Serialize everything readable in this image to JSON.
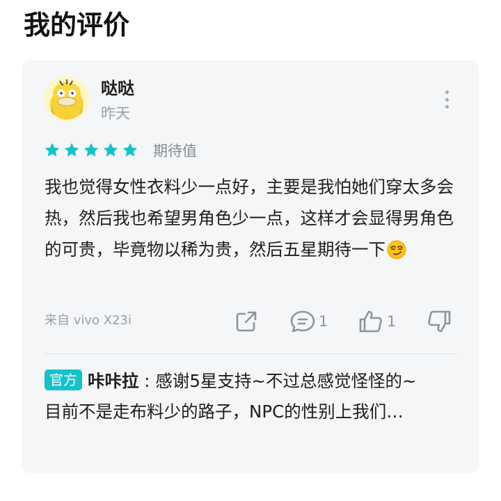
{
  "page": {
    "title": "我的评价"
  },
  "review": {
    "user_name": "哒哒",
    "time": "昨天",
    "rating": 5,
    "rating_max": 5,
    "rating_label": "期待值",
    "star_color": "#16c1c8",
    "text": "我也觉得女性衣料少一点好，主要是我怕她们穿太多会热，然后我也希望男角色少一点，这样才会显得男角色的可贵，毕竟物以稀为贵，然后五星期待一下",
    "emoji": "smirk-emoji",
    "device": "来自 vivo X23i"
  },
  "actions": {
    "share_icon": "share-icon",
    "comment_icon": "comment-icon",
    "comment_count": "1",
    "like_icon": "thumbs-up-icon",
    "like_count": "1",
    "dislike_icon": "thumbs-down-icon"
  },
  "reply": {
    "badge": "官方",
    "badge_color": "#16c1c8",
    "author": "咔咔拉",
    "separator": " : ",
    "text_line1": "感谢5星支持~不过总感觉怪怪的~",
    "text_line2": "目前不是走布料少的路子，NPC的性别上我们…"
  }
}
